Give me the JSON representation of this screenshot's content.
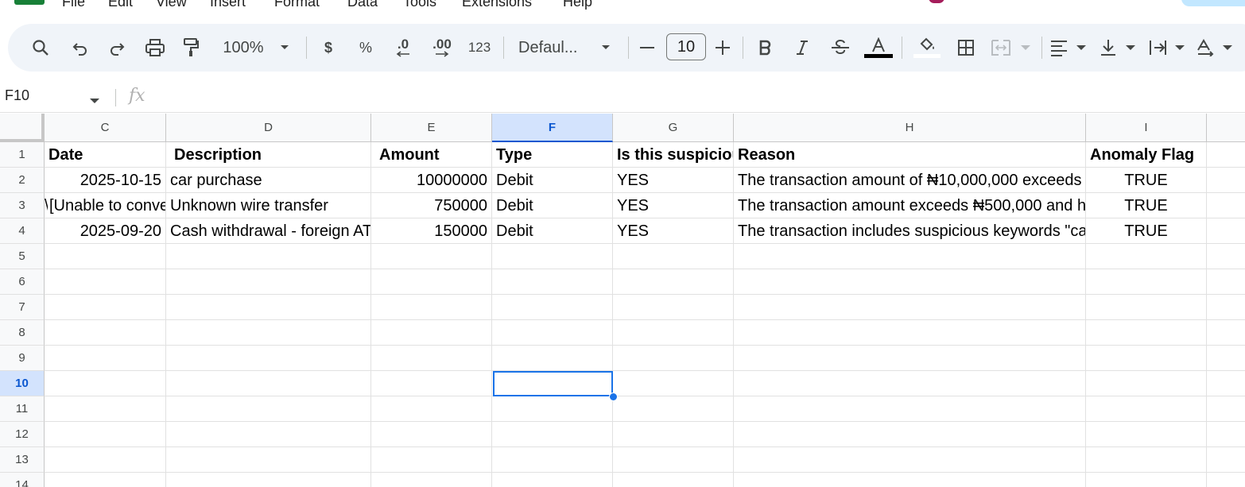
{
  "menu": {
    "items": [
      "File",
      "Edit",
      "View",
      "Insert",
      "Format",
      "Data",
      "Tools",
      "Extensions",
      "Help"
    ]
  },
  "toolbar": {
    "zoom": "100%",
    "currency_label": "$",
    "percent_label": "%",
    "decrease_decimal_label": ".0",
    "increase_decimal_label": ".00",
    "format_more_label": "123",
    "font_family": "Defaul...",
    "font_size": "10",
    "icons": [
      "search-icon",
      "undo-icon",
      "redo-icon",
      "print-icon",
      "paint-format-icon",
      "minus-icon",
      "plus-icon",
      "bold-icon",
      "italic-icon",
      "strikethrough-icon",
      "text-color-icon",
      "fill-color-icon",
      "borders-icon",
      "merge-cells-icon",
      "align-left-icon",
      "vertical-align-icon",
      "text-wrap-icon",
      "text-rotation-icon"
    ]
  },
  "formula_bar": {
    "name_box": "F10",
    "fx_label": "fx",
    "content": ""
  },
  "grid": {
    "columns": [
      "C",
      "D",
      "E",
      "F",
      "G",
      "H",
      "I"
    ],
    "selected_column": "F",
    "rows": [
      "1",
      "2",
      "3",
      "4",
      "5",
      "6",
      "7",
      "8",
      "9",
      "10",
      "11",
      "12",
      "13",
      "14"
    ],
    "selected_row": "10",
    "selected_cell": "F10",
    "b3_overflow": "\\",
    "header_row": {
      "c": "Date",
      "d": "Description",
      "e": "Amount",
      "f": "Type",
      "g": "Is this suspicious",
      "h": "Reason",
      "i": "Anomaly Flag"
    },
    "data_rows": [
      {
        "c": "2025-10-15",
        "d": "car purchase",
        "e": "10000000",
        "f": "Debit",
        "g": "YES",
        "h": "The transaction amount of ₦10,000,000 exceeds",
        "i": "TRUE"
      },
      {
        "c": "[Unable to convert",
        "d": "Unknown wire transfer",
        "e": "750000",
        "f": "Debit",
        "g": "YES",
        "h": "The transaction amount exceeds ₦500,000 and h",
        "i": "TRUE"
      },
      {
        "c": "2025-09-20",
        "d": "Cash withdrawal - foreign ATM",
        "e": "150000",
        "f": "Debit",
        "g": "YES",
        "h": "The transaction includes suspicious keywords \"ca",
        "i": "TRUE"
      }
    ]
  }
}
